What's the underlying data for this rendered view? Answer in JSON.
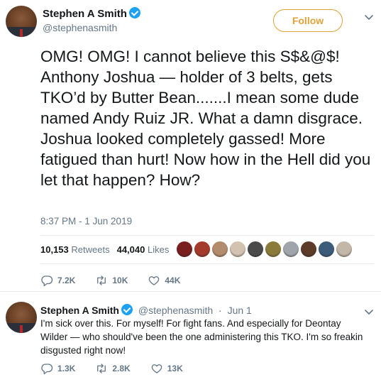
{
  "tweet": {
    "author_name": "Stephen A Smith",
    "author_handle": "@stephenasmith",
    "follow_label": "Follow",
    "text": "OMG! OMG! I cannot believe this S$&@$! Anthony Joshua — holder of 3 belts, gets TKO’d by Butter Bean.......I mean some dude named Andy Ruiz JR. What a damn disgrace. Joshua looked completely gassed! More fatigued than hurt! Now how in the Hell did you let that happen? How?",
    "timestamp": "8:37 PM - 1 Jun 2019",
    "retweets_count": "10,153",
    "retweets_label": "Retweets",
    "likes_count": "44,040",
    "likes_label": "Likes",
    "reply_count": "7.2K",
    "retweet_count_short": "10K",
    "like_count_short": "44K"
  },
  "reply": {
    "author_name": "Stephen A Smith",
    "author_handle": "@stephenasmith",
    "separator": "·",
    "date": "Jun 1",
    "text": "I'm sick over this. For myself! For fight fans. And especially for Deontay Wilder — who should've been the one administering this TKO. I'm so freakin disgusted right now!",
    "reply_count": "1.3K",
    "retweet_count": "2.8K",
    "like_count": "13K"
  },
  "likers": [
    {
      "icon": "liker-avatar",
      "color": "#7a1f1f"
    },
    {
      "icon": "liker-avatar",
      "color": "#a33a2c"
    },
    {
      "icon": "liker-avatar",
      "color": "#b38b6d"
    },
    {
      "icon": "liker-avatar",
      "color": "#d3c2b0"
    },
    {
      "icon": "liker-avatar",
      "color": "#4a4a4a"
    },
    {
      "icon": "liker-avatar",
      "color": "#8b7b3a"
    },
    {
      "icon": "liker-avatar",
      "color": "#9fa5aa"
    },
    {
      "icon": "liker-avatar",
      "color": "#5c3b2a"
    },
    {
      "icon": "liker-avatar",
      "color": "#3d5c7a"
    },
    {
      "icon": "liker-avatar",
      "color": "#c2b7a8"
    }
  ],
  "colors": {
    "follow_accent": "#e0a23a",
    "verified": "#1da1f2",
    "secondary_text": "#657786"
  }
}
